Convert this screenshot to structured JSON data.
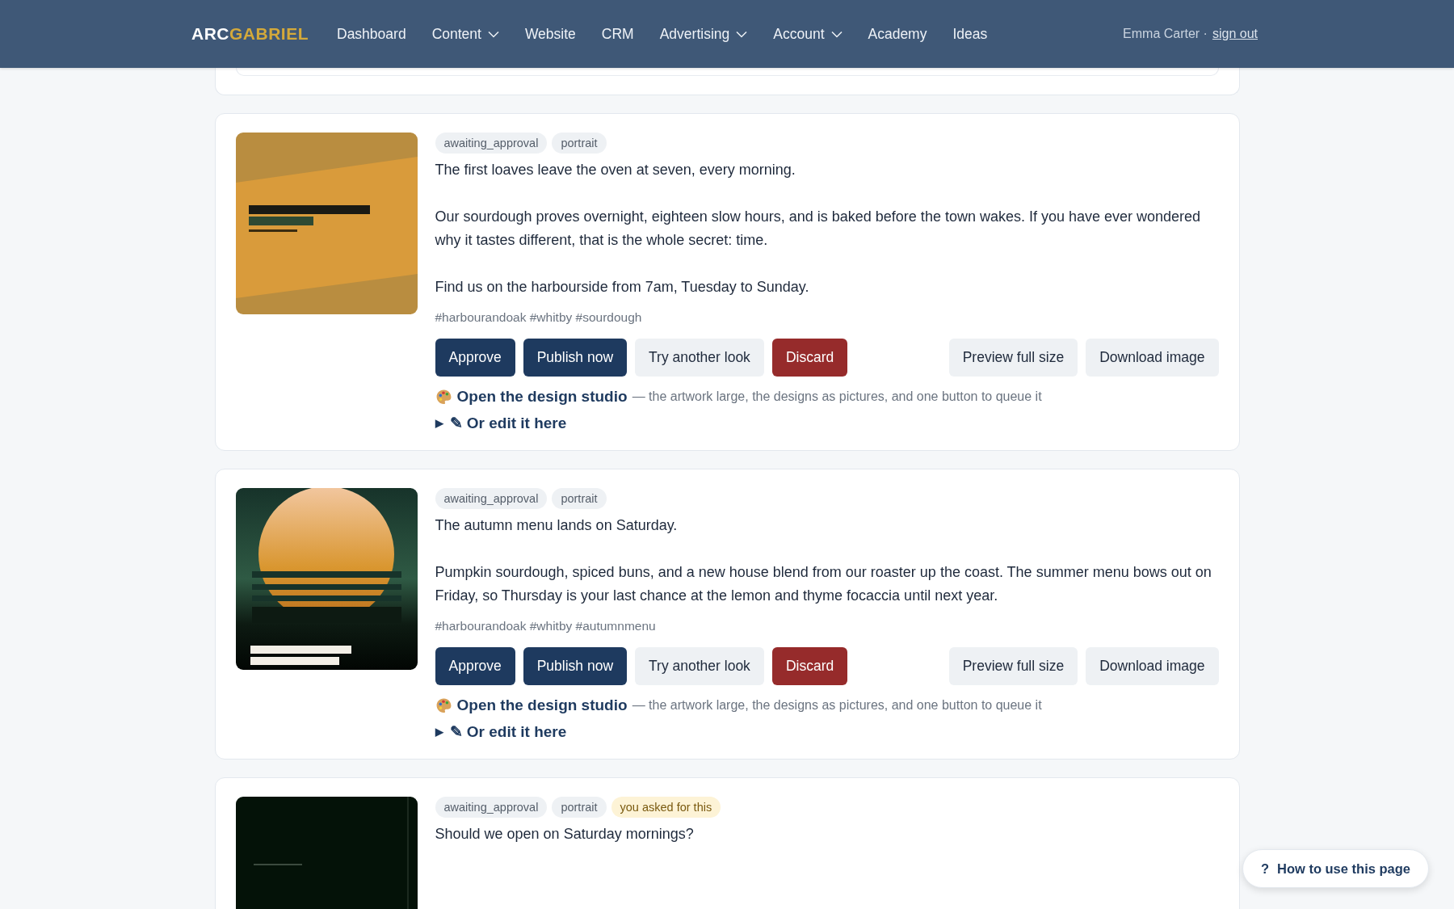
{
  "nav": {
    "brand": {
      "first": "ARC",
      "second": "GABRIEL"
    },
    "items": [
      {
        "label": "Dashboard",
        "dropdown": false
      },
      {
        "label": "Content",
        "dropdown": true
      },
      {
        "label": "Website",
        "dropdown": false
      },
      {
        "label": "CRM",
        "dropdown": false
      },
      {
        "label": "Advertising",
        "dropdown": true
      },
      {
        "label": "Account",
        "dropdown": true
      },
      {
        "label": "Academy",
        "dropdown": false
      },
      {
        "label": "Ideas",
        "dropdown": false
      }
    ],
    "user": "Emma Carter ·",
    "sign_out": "sign out"
  },
  "posts": [
    {
      "artwork": {
        "kind": "picture"
      },
      "tags": [
        {
          "label": "awaiting_approval",
          "kind": "status"
        },
        {
          "label": "portrait",
          "kind": "format"
        }
      ],
      "paragraphs": [
        "The first loaves leave the oven at seven, every morning.",
        "Our sourdough proves overnight, eighteen slow hours, and is baked before the town wakes. If you have ever wondered why it tastes different, that is the whole secret: time.",
        "Find us on the harbourside from 7am, Tuesday to Sunday."
      ],
      "hashtags": "#harbourandoak #whitby #sourdough",
      "actions": [
        {
          "label": "Approve",
          "kind": "primary"
        },
        {
          "label": "Publish now",
          "kind": "primary"
        },
        {
          "label": "Try another look",
          "kind": "secondary"
        },
        {
          "label": "Discard",
          "kind": "danger"
        }
      ],
      "image_actions": [
        "Preview full size",
        "Download image"
      ],
      "studio": {
        "label": "Open the design studio",
        "note": "— the artwork large, the designs as pictures, and one button to queue it"
      },
      "edit": {
        "marker": "▶",
        "icon": "✎",
        "label": "Or edit it here",
        "expanded": false
      }
    },
    {
      "artwork": {
        "kind": "picture"
      },
      "tags": [
        {
          "label": "awaiting_approval",
          "kind": "status"
        },
        {
          "label": "portrait",
          "kind": "format"
        }
      ],
      "paragraphs": [
        "The autumn menu lands on Saturday.",
        "Pumpkin sourdough, spiced buns, and a new house blend from our roaster up the coast. The summer menu bows out on Friday, so Thursday is your last chance at the lemon and thyme focaccia until next year."
      ],
      "hashtags": "#harbourandoak #whitby #autumnmenu",
      "actions": [
        {
          "label": "Approve",
          "kind": "primary"
        },
        {
          "label": "Publish now",
          "kind": "primary"
        },
        {
          "label": "Try another look",
          "kind": "secondary"
        },
        {
          "label": "Discard",
          "kind": "danger"
        }
      ],
      "image_actions": [
        "Preview full size",
        "Download image"
      ],
      "studio": {
        "label": "Open the design studio",
        "note": "— the artwork large, the designs as pictures, and one button to queue it"
      },
      "edit": {
        "marker": "▶",
        "icon": "✎",
        "label": "Or edit it here",
        "expanded": false
      }
    },
    {
      "artwork": {
        "kind": "picture"
      },
      "tags": [
        {
          "label": "awaiting_approval",
          "kind": "status"
        },
        {
          "label": "portrait",
          "kind": "format"
        },
        {
          "label": "you asked for this",
          "kind": "request"
        }
      ],
      "paragraphs": [
        "Should we open on Saturday mornings?"
      ]
    }
  ],
  "help": {
    "icon": "?",
    "label": "How to use this page"
  }
}
